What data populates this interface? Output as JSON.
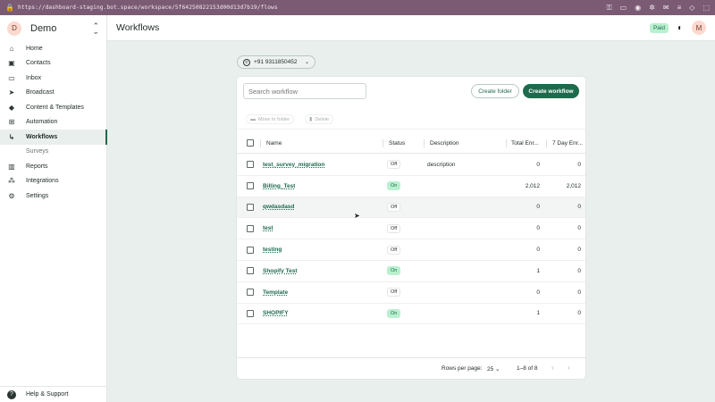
{
  "browser": {
    "url": "https://dashboard-staging.bot.space/workspace/5f64250822153d00d13d7b19/flows",
    "tools": [
      "key-icon",
      "screen-icon",
      "camera-icon",
      "extension-icon",
      "email-icon",
      "menu-icon",
      "code-icon",
      "download-icon"
    ]
  },
  "workspace": {
    "initial": "D",
    "name": "Demo"
  },
  "sidebar": {
    "items": [
      {
        "label": "Home",
        "icon": "home-icon"
      },
      {
        "label": "Contacts",
        "icon": "contacts-icon"
      },
      {
        "label": "Inbox",
        "icon": "inbox-icon"
      },
      {
        "label": "Broadcast",
        "icon": "broadcast-icon"
      },
      {
        "label": "Content & Templates",
        "icon": "templates-icon"
      },
      {
        "label": "Automation",
        "icon": "automation-icon"
      },
      {
        "label": "Workflows",
        "icon": "workflow-icon"
      },
      {
        "label": "Surveys",
        "icon": ""
      },
      {
        "label": "Reports",
        "icon": "reports-icon"
      },
      {
        "label": "Integrations",
        "icon": "integrations-icon"
      },
      {
        "label": "Settings",
        "icon": "settings-icon"
      }
    ],
    "help": "Help & Support"
  },
  "header": {
    "title": "Workflows",
    "plan_badge": "Paid",
    "user_initial": "M"
  },
  "phone_selector": {
    "value": "+91 9311850452"
  },
  "toolbar": {
    "search_placeholder": "Search workflow",
    "create_folder": "Create folder",
    "create_workflow": "Create workflow"
  },
  "bulk_actions": {
    "move": "Move to folder",
    "delete": "Delete"
  },
  "table": {
    "columns": [
      "Name",
      "Status",
      "Description",
      "Total Enr...",
      "7 Day Enr..."
    ],
    "rows": [
      {
        "name": "test_survey_migration",
        "status": "Off",
        "description": "description",
        "total": "0",
        "seven_day": "0"
      },
      {
        "name": "Billing_Test",
        "status": "On",
        "description": "",
        "total": "2,012",
        "seven_day": "2,012"
      },
      {
        "name": "qwdasdasd",
        "status": "Off",
        "description": "",
        "total": "0",
        "seven_day": "0"
      },
      {
        "name": "test",
        "status": "Off",
        "description": "",
        "total": "0",
        "seven_day": "0"
      },
      {
        "name": "testing",
        "status": "Off",
        "description": "",
        "total": "0",
        "seven_day": "0"
      },
      {
        "name": "Shopify Test",
        "status": "On",
        "description": "",
        "total": "1",
        "seven_day": "0"
      },
      {
        "name": "Template",
        "status": "Off",
        "description": "",
        "total": "0",
        "seven_day": "0"
      },
      {
        "name": "SHOPIFY",
        "status": "On",
        "description": "",
        "total": "1",
        "seven_day": "0"
      }
    ]
  },
  "pagination": {
    "rows_per_page_label": "Rows per page:",
    "rows_per_page": "25",
    "range": "1–8 of 8"
  },
  "colors": {
    "brand": "#1e6a4d",
    "on_badge": "#b9f0cf",
    "browser_bar": "#7a5b73"
  }
}
